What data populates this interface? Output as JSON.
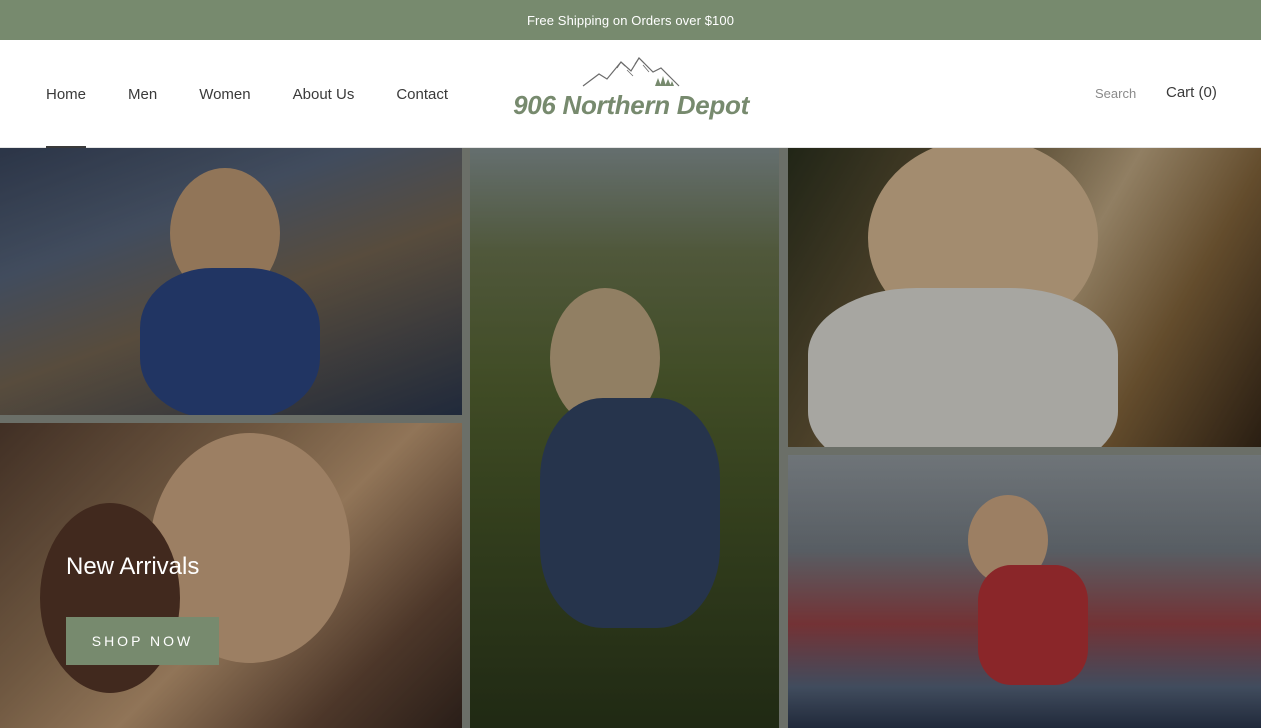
{
  "announcement": {
    "text": "Free Shipping on Orders over $100"
  },
  "nav": {
    "items": [
      {
        "label": "Home"
      },
      {
        "label": "Men"
      },
      {
        "label": "Women"
      },
      {
        "label": "About Us"
      },
      {
        "label": "Contact"
      }
    ],
    "active_index": 0
  },
  "logo": {
    "text": "906 Northern Depot",
    "icon": "mountains-icon"
  },
  "header_actions": {
    "search_label": "Search",
    "cart_label": "Cart (0)"
  },
  "hero": {
    "title": "New Arrivals",
    "cta_label": "SHOP NOW"
  },
  "colors": {
    "brand": "#778a6e",
    "text": "#3a3a3a",
    "muted": "#8a8a8a",
    "white": "#ffffff"
  }
}
